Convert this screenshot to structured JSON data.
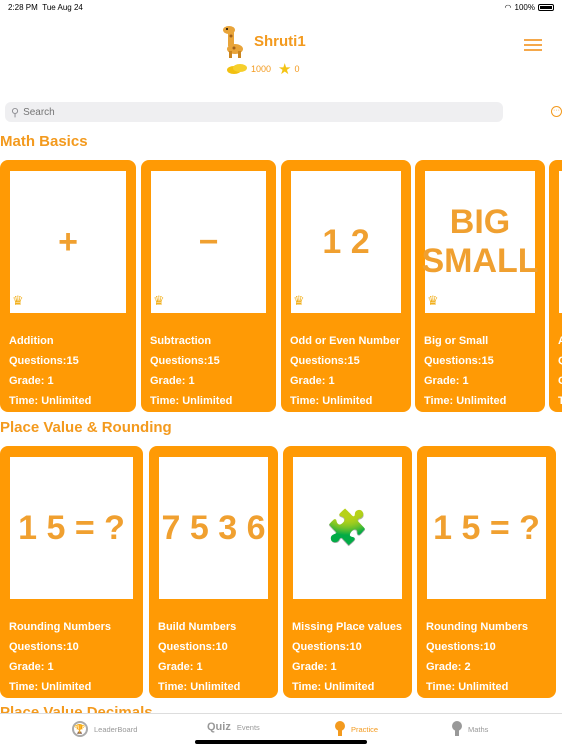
{
  "status": {
    "time": "2:28 PM",
    "date": "Tue Aug 24",
    "battery": "100%"
  },
  "profile": {
    "name": "Shruti1",
    "coins": "1000",
    "stars": "0"
  },
  "search": {
    "placeholder": "Search"
  },
  "sections": [
    {
      "title": "Math Basics",
      "cards": [
        {
          "title": "Addition",
          "questions": "Questions:15",
          "grade": "Grade:  1",
          "time": "Time: Unlimited",
          "art": "+"
        },
        {
          "title": "Subtraction",
          "questions": "Questions:15",
          "grade": "Grade:  1",
          "time": "Time: Unlimited",
          "art": "−"
        },
        {
          "title": "Odd or Even Number",
          "questions": "Questions:15",
          "grade": "Grade:  1",
          "time": "Time: Unlimited",
          "art": "1 2"
        },
        {
          "title": "Big or Small",
          "questions": "Questions:15",
          "grade": "Grade:  1",
          "time": "Time: Unlimited",
          "art": "BIG SMALL"
        },
        {
          "title": "A",
          "questions": "Q",
          "grade": "G",
          "time": "T",
          "art": ""
        }
      ]
    },
    {
      "title": "Place Value & Rounding",
      "cards": [
        {
          "title": "Rounding Numbers",
          "questions": "Questions:10",
          "grade": "Grade:  1",
          "time": "Time: Unlimited",
          "art": "1 5 = ?"
        },
        {
          "title": "Build Numbers",
          "questions": "Questions:10",
          "grade": "Grade:  1",
          "time": "Time: Unlimited",
          "art": "7 5 3 6"
        },
        {
          "title": "Missing Place values",
          "questions": "Questions:10",
          "grade": "Grade:  1",
          "time": "Time: Unlimited",
          "art": "🧩"
        },
        {
          "title": "Rounding Numbers",
          "questions": "Questions:10",
          "grade": "Grade:  2",
          "time": "Time: Unlimited",
          "art": "1 5 = ?"
        }
      ]
    },
    {
      "title": "Place Value Decimals"
    }
  ],
  "tabs": [
    {
      "label": "LeaderBoard",
      "icon": "trophy-icon"
    },
    {
      "label": "Events",
      "icon": "quiz-icon",
      "logo": "Quiz"
    },
    {
      "label": "Practice",
      "icon": "bulb-icon",
      "active": true
    },
    {
      "label": "Maths",
      "icon": "bulb-icon"
    }
  ],
  "colors": {
    "accent": "#f39a1e",
    "card": "#ff9a05"
  }
}
